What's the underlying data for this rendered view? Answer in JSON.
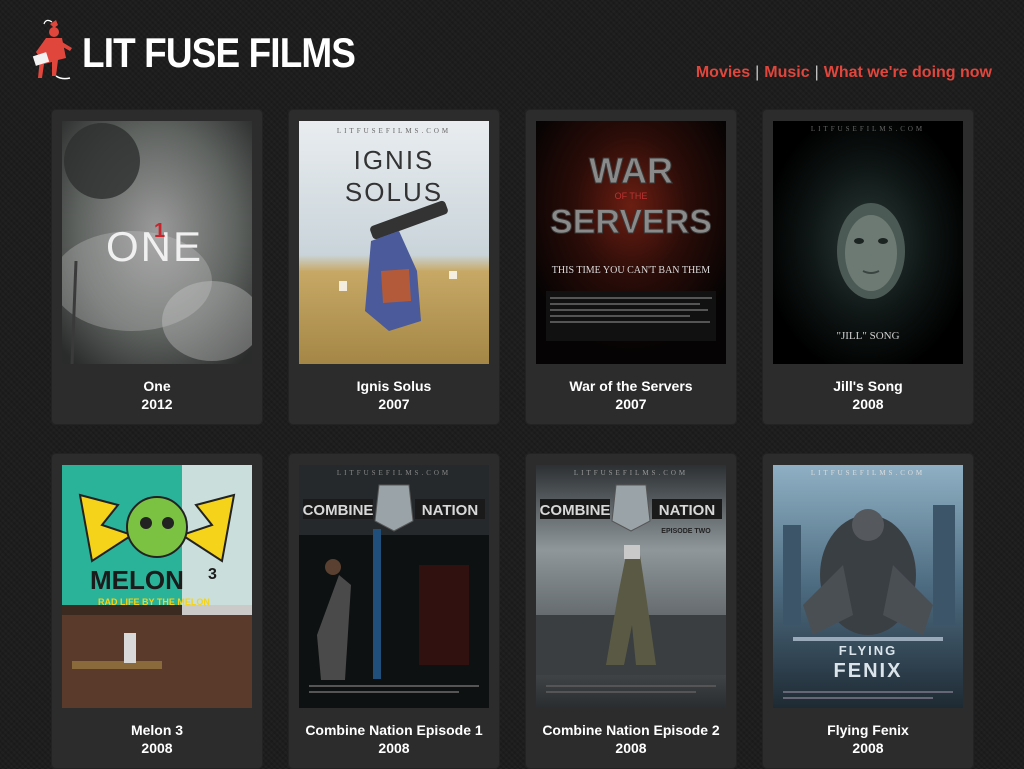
{
  "site": {
    "logo_text": "LIT FUSE FILMS",
    "logo_icon": "runner-with-fuse-icon"
  },
  "nav": {
    "items": [
      {
        "label": "Movies"
      },
      {
        "label": "Music"
      },
      {
        "label": "What we're doing now"
      }
    ],
    "separator": "|"
  },
  "colors": {
    "accent": "#e0463c",
    "background": "#1b1b1b",
    "card": "#2c2c2c",
    "text": "#ffffff"
  },
  "films": [
    {
      "title": "One",
      "year": "2012",
      "poster_text": "ONE",
      "poster_watermark": ""
    },
    {
      "title": "Ignis Solus",
      "year": "2007",
      "poster_text": "IGNIS SOLUS",
      "poster_watermark": "LITFUSEFILMS.COM"
    },
    {
      "title": "War of the Servers",
      "year": "2007",
      "poster_text": "WAR OF THE SERVERS",
      "poster_tagline": "THIS TIME YOU CAN'T BAN THEM"
    },
    {
      "title": "Jill's Song",
      "year": "2008",
      "poster_text": "JILL'S SONG",
      "poster_watermark": "LITFUSEFILMS.COM"
    },
    {
      "title": "Melon 3",
      "year": "2008",
      "poster_text": "MELON",
      "poster_tagline": "RAD LIFE BY THE MELON"
    },
    {
      "title": "Combine Nation Episode 1",
      "year": "2008",
      "poster_text": "COMBINE NATION",
      "poster_watermark": "LITFUSEFILMS.COM"
    },
    {
      "title": "Combine Nation Episode 2",
      "year": "2008",
      "poster_text": "COMBINE NATION",
      "poster_subtext": "EPISODE TWO",
      "poster_watermark": "LITFUSEFILMS.COM"
    },
    {
      "title": "Flying Fenix",
      "year": "2008",
      "poster_text": "FLYING FENIX",
      "poster_watermark": "LITFUSEFILMS.COM"
    }
  ]
}
